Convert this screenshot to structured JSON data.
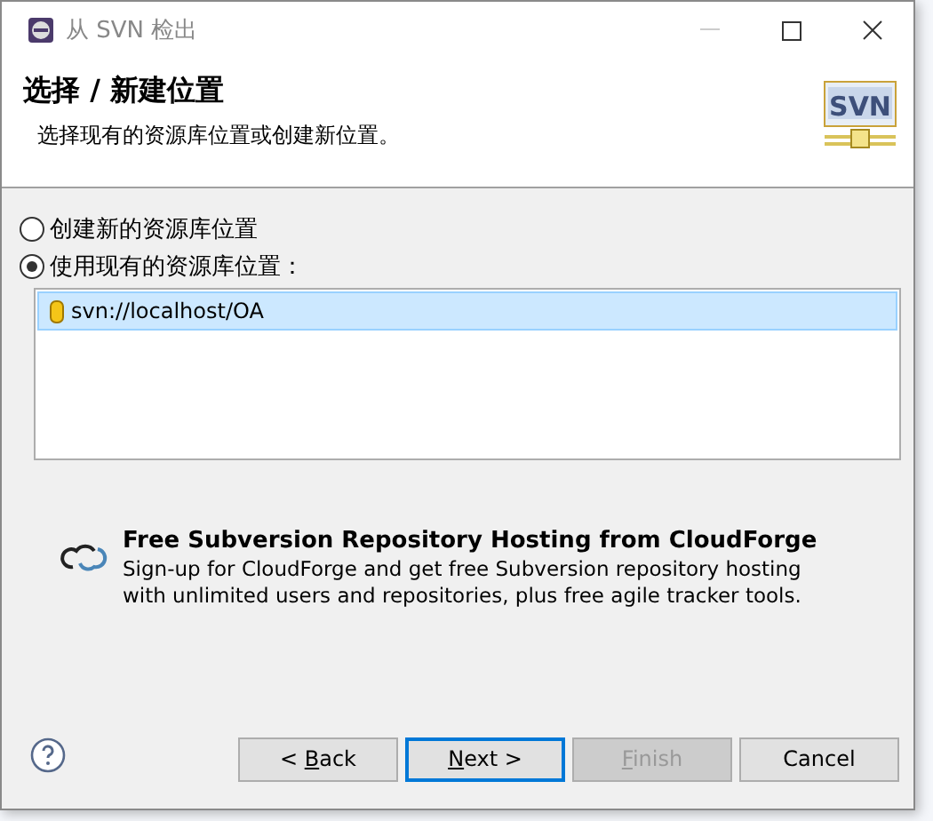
{
  "window": {
    "title": "从 SVN 检出"
  },
  "header": {
    "logo_text": "SVN",
    "title": "选择 / 新建位置",
    "description": "选择现有的资源库位置或创建新位置。"
  },
  "options": [
    {
      "label": "创建新的资源库位置",
      "selected": false
    },
    {
      "label": "使用现有的资源库位置：",
      "selected": true
    }
  ],
  "locations": [
    {
      "url": "svn://localhost/OA",
      "selected": true
    }
  ],
  "promo": {
    "title": "Free Subversion Repository Hosting from CloudForge",
    "text": "Sign-up for CloudForge and get free Subversion repository hosting with unlimited users and repositories, plus free agile tracker tools."
  },
  "buttons": [
    {
      "pre": "< ",
      "key": "B",
      "post": "ack",
      "disabled": false,
      "default": false
    },
    {
      "key": "N",
      "post": "ext >",
      "disabled": false,
      "default": true
    },
    {
      "key": "F",
      "post": "inish",
      "disabled": true,
      "default": false
    },
    {
      "pre": "Cancel",
      "disabled": false,
      "default": false
    }
  ]
}
